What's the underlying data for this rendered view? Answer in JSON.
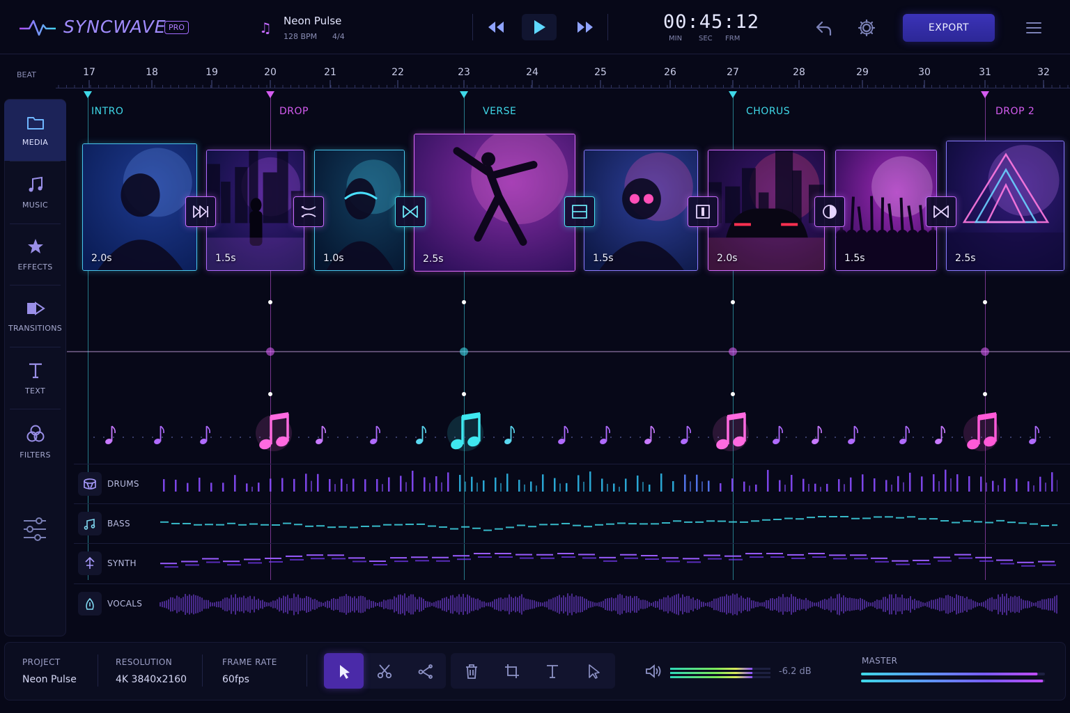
{
  "app": {
    "name": "SYNCWAVE",
    "badge": "PRO"
  },
  "track": {
    "name": "Neon Pulse",
    "bpm": "128 BPM",
    "time_signature": "4/4"
  },
  "transport": {
    "rewind_icon": "rewind-icon",
    "play_icon": "play-icon",
    "forward_icon": "fast-forward-icon"
  },
  "timecode": {
    "value": "00:45:12",
    "min_label": "MIN",
    "sec_label": "SEC",
    "frm_label": "FRM"
  },
  "toolbar": {
    "export_label": "EXPORT",
    "undo_icon": "undo-icon",
    "settings_icon": "gear-icon",
    "menu_icon": "hamburger-menu-icon"
  },
  "ruler": {
    "label": "BEAT",
    "beats": [
      "17",
      "18",
      "19",
      "20",
      "21",
      "22",
      "23",
      "24",
      "25",
      "26",
      "27",
      "28",
      "29",
      "30",
      "31",
      "32"
    ]
  },
  "sidebar": {
    "items": [
      {
        "label": "MEDIA",
        "icon": "folder-icon",
        "active": true
      },
      {
        "label": "MUSIC",
        "icon": "music-note-icon"
      },
      {
        "label": "EFFECTS",
        "icon": "star-icon"
      },
      {
        "label": "TRANSITIONS",
        "icon": "transitions-icon"
      },
      {
        "label": "TEXT",
        "icon": "text-icon"
      },
      {
        "label": "FILTERS",
        "icon": "filters-icon"
      },
      {
        "label": "",
        "icon": "sliders-icon"
      }
    ]
  },
  "markers": [
    {
      "label": "INTRO",
      "color": "#3fd8e8"
    },
    {
      "label": "DROP",
      "color": "#d45cf0"
    },
    {
      "label": "VERSE",
      "color": "#3fd8e8"
    },
    {
      "label": "CHORUS",
      "color": "#3fd8e8"
    },
    {
      "label": "DROP 2",
      "color": "#d45cf0"
    }
  ],
  "clips": [
    {
      "duration": "2.0s",
      "subject": "woman-portrait"
    },
    {
      "duration": "1.5s",
      "subject": "city-street"
    },
    {
      "duration": "1.0s",
      "subject": "helmet-rider"
    },
    {
      "duration": "2.5s",
      "subject": "dancer-jump"
    },
    {
      "duration": "1.5s",
      "subject": "woman-glasses"
    },
    {
      "duration": "2.0s",
      "subject": "car-neon"
    },
    {
      "duration": "1.5s",
      "subject": "concert-crowd"
    },
    {
      "duration": "2.5s",
      "subject": "neon-triangle"
    }
  ],
  "transitions": [
    {
      "icon": "fast-forward-transition-icon"
    },
    {
      "icon": "shuffle-cross-icon"
    },
    {
      "icon": "bowtie-icon"
    },
    {
      "icon": "split-horizontal-icon"
    },
    {
      "icon": "split-vertical-icon"
    },
    {
      "icon": "half-circle-icon"
    },
    {
      "icon": "bowtie-icon"
    }
  ],
  "tracks": [
    {
      "name": "DRUMS",
      "icon": "drum-icon"
    },
    {
      "name": "BASS",
      "icon": "bass-icon"
    },
    {
      "name": "SYNTH",
      "icon": "synth-icon"
    },
    {
      "name": "VOCALS",
      "icon": "vocals-icon"
    }
  ],
  "project": {
    "project_label": "PROJECT",
    "project_value": "Neon Pulse",
    "resolution_label": "RESOLUTION",
    "resolution_value": "4K 3840x2160",
    "framerate_label": "FRAME RATE",
    "framerate_value": "60fps"
  },
  "tools": [
    {
      "icon": "select-arrow-icon",
      "active": true
    },
    {
      "icon": "scissors-icon"
    },
    {
      "icon": "split-icon"
    },
    {
      "icon": "trash-icon"
    },
    {
      "icon": "crop-icon"
    },
    {
      "icon": "text-tool-icon"
    },
    {
      "icon": "pointer-icon"
    }
  ],
  "volume": {
    "db": "-6.2 dB",
    "level": 0.82
  },
  "master": {
    "label": "MASTER",
    "levels": [
      0.96,
      0.99
    ]
  },
  "colors": {
    "cyan": "#3fd8e8",
    "magenta": "#d45cf0",
    "purple": "#8a4dff",
    "accent": "#3b33b8"
  }
}
